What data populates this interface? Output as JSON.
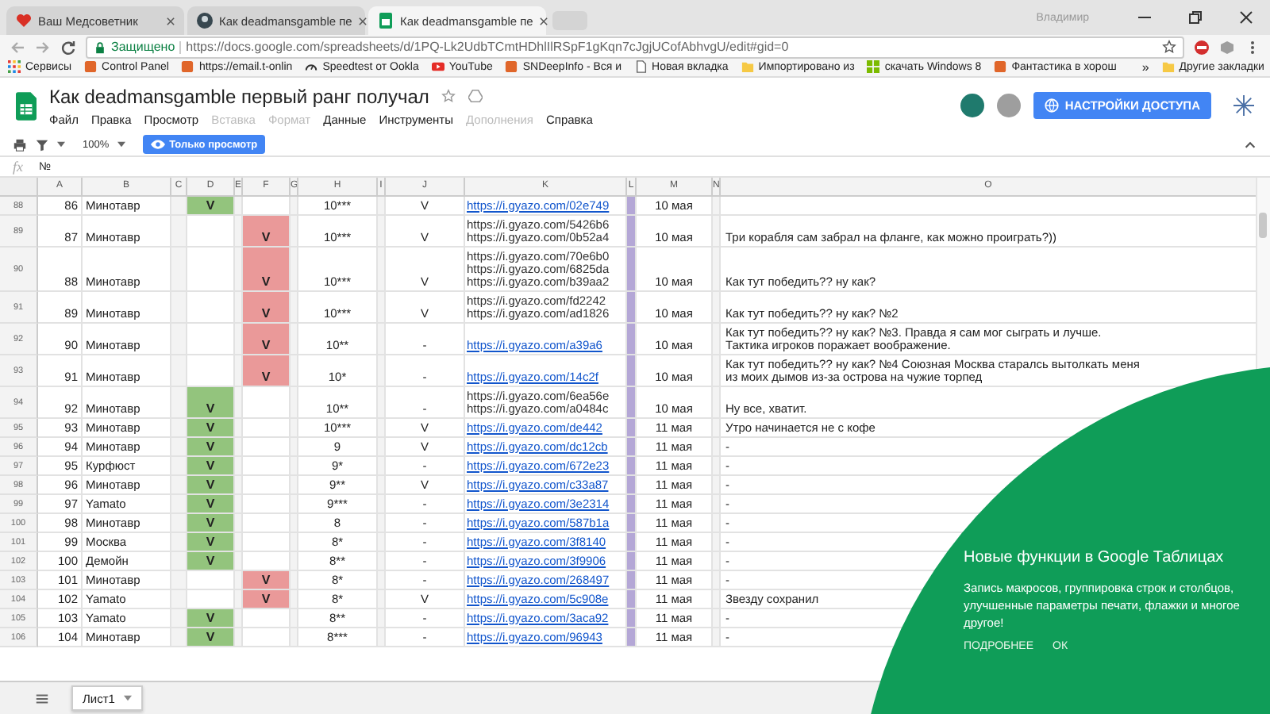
{
  "browser": {
    "tabs": [
      {
        "title": "Ваш Медсоветник",
        "selected": false
      },
      {
        "title": "Как deadmansgamble пе",
        "selected": false
      },
      {
        "title": "Как deadmansgamble пе",
        "selected": true
      }
    ],
    "user": "Владимир",
    "secure_label": "Защищено",
    "url": "https://docs.google.com/spreadsheets/d/1PQ-Lk2UdbTCmtHDhlIlRSpF1gKqn7cJgjUCofAbhvgU/edit#gid=0",
    "bookmarks": [
      {
        "label": "Сервисы",
        "kind": "apps"
      },
      {
        "label": "Control Panel",
        "kind": "site"
      },
      {
        "label": "https://email.t-onlin",
        "kind": "site"
      },
      {
        "label": "Speedtest от Ookla",
        "kind": "gauge"
      },
      {
        "label": "YouTube",
        "kind": "play"
      },
      {
        "label": "SNDeepInfo - Вся и",
        "kind": "site"
      },
      {
        "label": "Новая вкладка",
        "kind": "page"
      },
      {
        "label": "Импортировано из",
        "kind": "folder"
      },
      {
        "label": "скачать Windows 8",
        "kind": "windows"
      },
      {
        "label": "Фантастика в хорош",
        "kind": "site"
      }
    ],
    "more": "»",
    "other_bookmarks": "Другие закладки"
  },
  "doc": {
    "title": "Как deadmansgamble первый ранг получал",
    "menu": [
      {
        "label": "Файл",
        "disabled": false
      },
      {
        "label": "Правка",
        "disabled": false
      },
      {
        "label": "Просмотр",
        "disabled": false
      },
      {
        "label": "Вставка",
        "disabled": true
      },
      {
        "label": "Формат",
        "disabled": true
      },
      {
        "label": "Данные",
        "disabled": false
      },
      {
        "label": "Инструменты",
        "disabled": false
      },
      {
        "label": "Дополнения",
        "disabled": true
      },
      {
        "label": "Справка",
        "disabled": false
      }
    ],
    "share_button": "НАСТРОЙКИ ДОСТУПА"
  },
  "toolbar": {
    "zoom": "100%",
    "view_only": "Только просмотр"
  },
  "formula_bar": {
    "fx": "fx",
    "value": "№"
  },
  "columns": [
    "A",
    "B",
    "C",
    "D",
    "E",
    "F",
    "G",
    "H",
    "I",
    "J",
    "K",
    "L",
    "M",
    "N",
    "O"
  ],
  "rows": [
    {
      "row": "88",
      "a": "86",
      "b": "Минотавр",
      "d": "V",
      "h": "10***",
      "j": "V",
      "k": [
        "https://i.gyazo.com/02e749"
      ],
      "hyperlink": true,
      "m": "10 мая"
    },
    {
      "row": "89",
      "a": "87",
      "b": "Минотавр",
      "f": "V",
      "h": "10***",
      "j": "V",
      "k": [
        "https://i.gyazo.com/5426b6",
        "https://i.gyazo.com/0b52a4"
      ],
      "hyperlink": false,
      "m": "10 мая",
      "o": "Три корабля сам забрал на фланге, как можно проиграть?))"
    },
    {
      "row": "90",
      "a": "88",
      "b": "Минотавр",
      "f": "V",
      "h": "10***",
      "j": "V",
      "k": [
        "https://i.gyazo.com/70e6b0",
        "https://i.gyazo.com/6825da",
        "https://i.gyazo.com/b39aa2"
      ],
      "hyperlink": false,
      "m": "10 мая",
      "o": "Как тут победить?? ну как?"
    },
    {
      "row": "91",
      "a": "89",
      "b": "Минотавр",
      "f": "V",
      "h": "10***",
      "j": "V",
      "k": [
        "https://i.gyazo.com/fd2242",
        "https://i.gyazo.com/ad1826"
      ],
      "hyperlink": false,
      "m": "10 мая",
      "o": "Как тут победить?? ну как? №2"
    },
    {
      "row": "92",
      "a": "90",
      "b": "Минотавр",
      "f": "V",
      "h": "10**",
      "j": "-",
      "k": [
        "https://i.gyazo.com/a39a6"
      ],
      "hyperlink": true,
      "m": "10 мая",
      "o": "Как тут победить?? ну как? №3. Правда я сам мог сыграть и лучше. Тактика игроков поражает воображение."
    },
    {
      "row": "93",
      "a": "91",
      "b": "Минотавр",
      "f": "V",
      "h": "10*",
      "j": "-",
      "k": [
        "https://i.gyazo.com/14c2f"
      ],
      "hyperlink": true,
      "m": "10 мая",
      "o": "Как тут победить?? ну как? №4 Союзная Москва старалсь вытолкать меня из моих дымов из-за острова на чужие торпед"
    },
    {
      "row": "94",
      "a": "92",
      "b": "Минотавр",
      "d": "V",
      "h": "10**",
      "j": "-",
      "k": [
        "https://i.gyazo.com/6ea56e",
        "https://i.gyazo.com/a0484c"
      ],
      "hyperlink": false,
      "m": "10 мая",
      "o": "Ну все, хватит."
    },
    {
      "row": "95",
      "a": "93",
      "b": "Минотавр",
      "d": "V",
      "h": "10***",
      "j": "V",
      "k": [
        "https://i.gyazo.com/de442"
      ],
      "hyperlink": true,
      "m": "11 мая",
      "o": "Утро начинается не с кофе"
    },
    {
      "row": "96",
      "a": "94",
      "b": "Минотавр",
      "d": "V",
      "h": "9",
      "j": "V",
      "k": [
        "https://i.gyazo.com/dc12cb"
      ],
      "hyperlink": true,
      "m": "11 мая",
      "o": "-"
    },
    {
      "row": "97",
      "a": "95",
      "b": "Курфюст",
      "d": "V",
      "h": "9*",
      "j": "-",
      "k": [
        "https://i.gyazo.com/672e23"
      ],
      "hyperlink": true,
      "m": "11 мая",
      "o": "-"
    },
    {
      "row": "98",
      "a": "96",
      "b": "Минотавр",
      "d": "V",
      "h": "9**",
      "j": "V",
      "k": [
        "https://i.gyazo.com/c33a87"
      ],
      "hyperlink": true,
      "m": "11 мая",
      "o": "-"
    },
    {
      "row": "99",
      "a": "97",
      "b": "Yamato",
      "d": "V",
      "h": "9***",
      "j": "-",
      "k": [
        "https://i.gyazo.com/3e2314"
      ],
      "hyperlink": true,
      "m": "11 мая",
      "o": "-"
    },
    {
      "row": "100",
      "a": "98",
      "b": "Минотавр",
      "d": "V",
      "h": "8",
      "j": "-",
      "k": [
        "https://i.gyazo.com/587b1a"
      ],
      "hyperlink": true,
      "m": "11 мая",
      "o": "-"
    },
    {
      "row": "101",
      "a": "99",
      "b": "Москва",
      "d": "V",
      "h": "8*",
      "j": "-",
      "k": [
        "https://i.gyazo.com/3f8140"
      ],
      "hyperlink": true,
      "m": "11 мая",
      "o": "-"
    },
    {
      "row": "102",
      "a": "100",
      "b": "Демойн",
      "d": "V",
      "h": "8**",
      "j": "-",
      "k": [
        "https://i.gyazo.com/3f9906"
      ],
      "hyperlink": true,
      "m": "11 мая",
      "o": "-"
    },
    {
      "row": "103",
      "a": "101",
      "b": "Минотавр",
      "f": "V",
      "h": "8*",
      "j": "-",
      "k": [
        "https://i.gyazo.com/268497"
      ],
      "hyperlink": true,
      "m": "11 мая",
      "o": "-"
    },
    {
      "row": "104",
      "a": "102",
      "b": "Yamato",
      "f": "V",
      "h": "8*",
      "j": "V",
      "k": [
        "https://i.gyazo.com/5c908e"
      ],
      "hyperlink": true,
      "m": "11 мая",
      "o": "Звезду сохранил"
    },
    {
      "row": "105",
      "a": "103",
      "b": "Yamato",
      "d": "V",
      "h": "8**",
      "j": "-",
      "k": [
        "https://i.gyazo.com/3aca92"
      ],
      "hyperlink": true,
      "m": "11 мая",
      "o": "-"
    },
    {
      "row": "106",
      "a": "104",
      "b": "Минотавр",
      "d": "V",
      "h": "8***",
      "j": "-",
      "k": [
        "https://i.gyazo.com/96943"
      ],
      "hyperlink": true,
      "m": "11 мая",
      "o": "-"
    }
  ],
  "sheet_tab": "Лист1",
  "promo": {
    "title": "Новые функции в Google Таблицах",
    "body": "Запись макросов, группировка строк и столбцов, улучшенные параметры печати, флажки и многое другое!",
    "actions": [
      "ПОДРОБНЕЕ",
      "ОК"
    ]
  }
}
